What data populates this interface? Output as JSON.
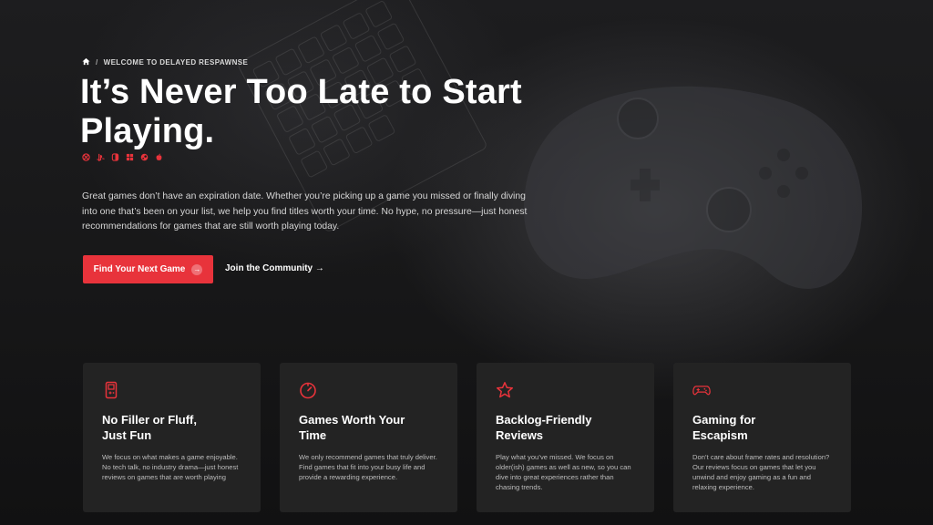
{
  "breadcrumb": {
    "home_icon": "home-icon",
    "separator": "/",
    "current": "WELCOME TO DELAYED RESPAWNSE"
  },
  "hero": {
    "headline": "It’s Never Too Late to Start Playing.",
    "platform_icons": [
      "xbox-icon",
      "playstation-icon",
      "nintendo-switch-icon",
      "windows-icon",
      "steam-icon",
      "apple-icon"
    ],
    "intro": "Great games don’t have an expiration date. Whether you’re picking up a game you missed or finally diving into one that’s been on your list, we help you find titles worth your time. No hype, no pressure—just honest recommendations for games that are still worth playing today.",
    "primary_cta": "Find Your Next Game",
    "secondary_cta": "Join the Community →"
  },
  "colors": {
    "accent": "#e8333b",
    "card_bg": "#232323",
    "page_bg": "#141414"
  },
  "features": [
    {
      "icon": "gameboy-icon",
      "title": "No Filler or Fluff, Just Fun",
      "body": "We focus on what makes a game enjoyable. No tech talk, no industry drama—just honest reviews on games that are worth playing"
    },
    {
      "icon": "timer-icon",
      "title": "Games Worth Your Time",
      "body": "We only recommend games that truly deliver. Find games that fit into your busy life and provide a rewarding experience."
    },
    {
      "icon": "star-icon",
      "title": "Backlog-Friendly Reviews",
      "body": "Play what you’ve missed. We focus on older(ish) games as well as new, so you can dive into great experiences rather than chasing trends."
    },
    {
      "icon": "gamepad-icon",
      "title": "Gaming for Escapism",
      "body": "Don’t care about frame rates and resolution? Our reviews focus on games that let you unwind and enjoy gaming as a fun and relaxing experience."
    }
  ]
}
